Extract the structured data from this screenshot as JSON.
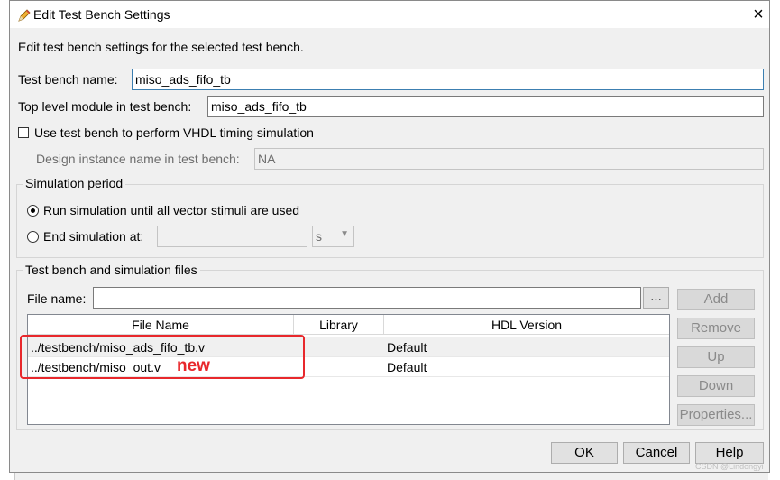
{
  "dialog": {
    "title": "Edit Test Bench Settings",
    "description": "Edit test bench settings for the selected test bench."
  },
  "testbench_name": {
    "label": "Test bench name:",
    "value": "miso_ads_fifo_tb"
  },
  "top_module": {
    "label": "Top level module in test bench:",
    "value": "miso_ads_fifo_tb"
  },
  "vhdl_timing": {
    "label": "Use test bench to perform VHDL timing simulation",
    "checked": false
  },
  "design_instance": {
    "label": "Design instance name in test bench:",
    "value": "NA"
  },
  "simulation_period": {
    "title": "Simulation period",
    "run_until_label": "Run simulation until all vector stimuli are used",
    "end_at_label": "End simulation at:",
    "end_at_value": "",
    "unit": "s",
    "selected": "run_until"
  },
  "files": {
    "title": "Test bench and simulation files",
    "file_name_label": "File name:",
    "file_name_value": "",
    "browse_label": "...",
    "columns": [
      "File Name",
      "Library",
      "HDL Version"
    ],
    "rows": [
      {
        "file": "../testbench/miso_ads_fifo_tb.v",
        "library": "",
        "hdl": "Default"
      },
      {
        "file": "../testbench/miso_out.v",
        "library": "",
        "hdl": "Default"
      }
    ],
    "annotation": "new",
    "buttons": {
      "add": "Add",
      "remove": "Remove",
      "up": "Up",
      "down": "Down",
      "properties": "Properties..."
    }
  },
  "footer": {
    "ok": "OK",
    "cancel": "Cancel",
    "help": "Help"
  },
  "watermark": "CSDN @Lindongyi",
  "colors": {
    "annotation": "#e8282c",
    "focus_border": "#3c7fb1",
    "dialog_bg": "#f0f0f0"
  },
  "icons": {
    "title": "pencil-icon",
    "close": "close-icon"
  }
}
